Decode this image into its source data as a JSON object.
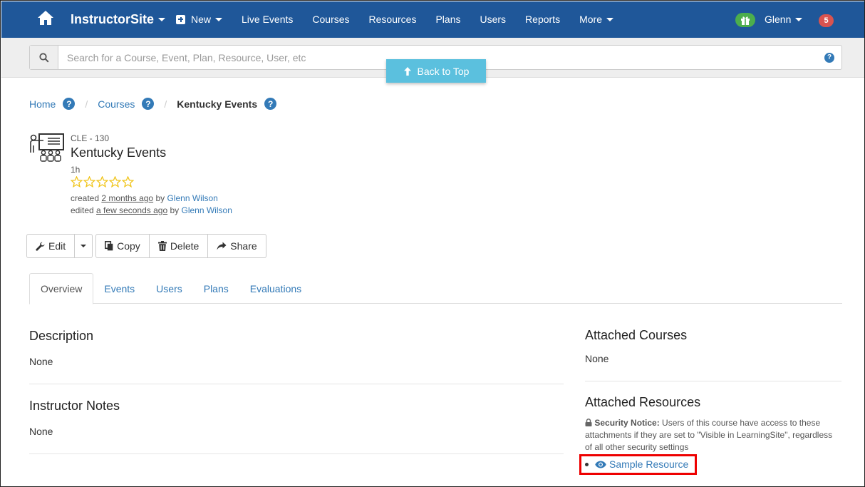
{
  "nav": {
    "brand": "InstructorSite",
    "items": [
      {
        "label": "New",
        "dropdown": true,
        "plus": true
      },
      {
        "label": "Live Events"
      },
      {
        "label": "Courses"
      },
      {
        "label": "Resources"
      },
      {
        "label": "Plans"
      },
      {
        "label": "Users"
      },
      {
        "label": "Reports"
      },
      {
        "label": "More",
        "dropdown": true
      }
    ],
    "user": "Glenn",
    "notifications": "5"
  },
  "search": {
    "placeholder": "Search for a Course, Event, Plan, Resource, User, etc",
    "help": "?"
  },
  "back_to_top": "Back to Top",
  "breadcrumb": {
    "home": "Home",
    "courses": "Courses",
    "current": "Kentucky Events",
    "help": "?",
    "sep": "/"
  },
  "course": {
    "code": "CLE - 130",
    "title": "Kentucky Events",
    "duration": "1h",
    "rating": 0,
    "rating_max": 5,
    "created_prefix": "created",
    "created_when": "2 months ago",
    "by": "by",
    "created_by": "Glenn Wilson",
    "edited_prefix": "edited",
    "edited_when": "a few seconds ago",
    "edited_by": "Glenn Wilson"
  },
  "actions": {
    "edit": "Edit",
    "copy": "Copy",
    "delete": "Delete",
    "share": "Share"
  },
  "tabs": [
    "Overview",
    "Events",
    "Users",
    "Plans",
    "Evaluations"
  ],
  "description": {
    "title": "Description",
    "body": "None"
  },
  "instructor_notes": {
    "title": "Instructor Notes",
    "body": "None"
  },
  "attached_courses": {
    "title": "Attached Courses",
    "body": "None"
  },
  "attached_resources": {
    "title": "Attached Resources",
    "notice_label": "Security Notice:",
    "notice_text": " Users of this course have access to these attachments if they are set to \"Visible in LearningSite\", regardless of all other security settings",
    "items": [
      "Sample Resource"
    ]
  },
  "colors": {
    "navbar": "#1f5799",
    "link": "#337ab7",
    "back_to_top": "#5bc0de",
    "gift_badge": "#4cae4c",
    "notification_badge": "#d9534f",
    "star": "#f0c419",
    "highlight": "#ee0000"
  }
}
